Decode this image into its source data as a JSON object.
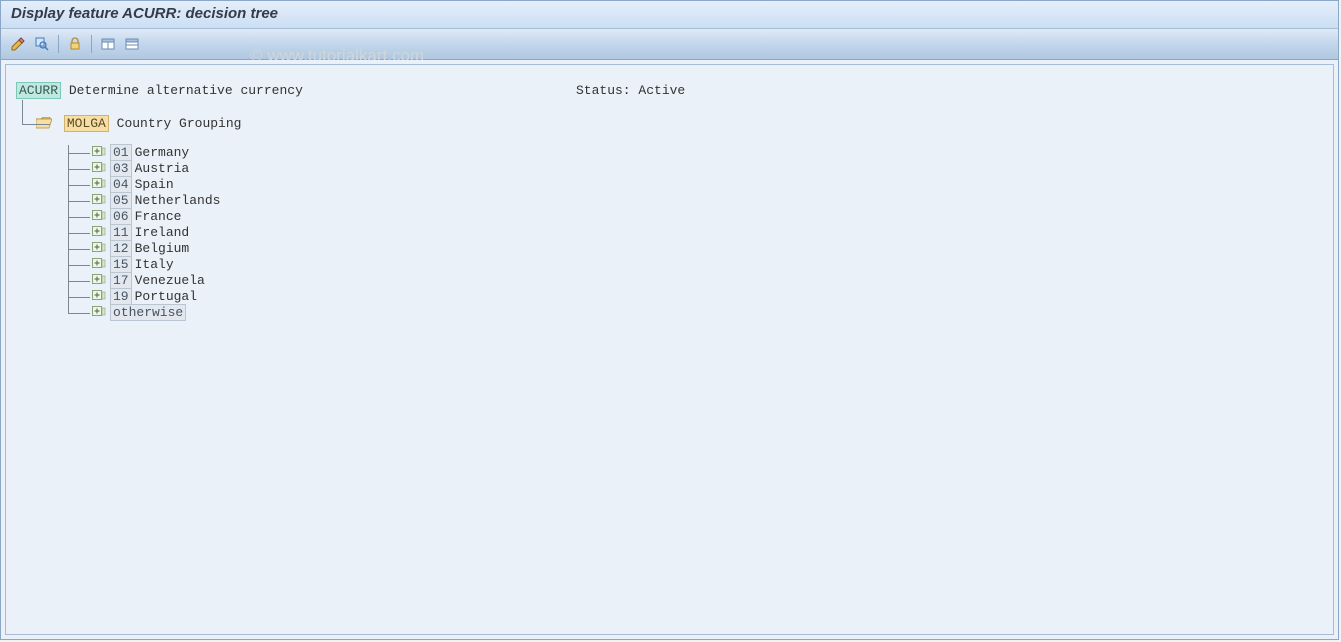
{
  "header": {
    "title": "Display feature ACURR: decision tree"
  },
  "toolbar": {
    "buttons": [
      "edit",
      "inspect",
      "lock",
      "layout1",
      "layout2"
    ]
  },
  "watermark": "© www.tutorialkart.com",
  "tree": {
    "root": {
      "code": "ACURR",
      "label": "Determine alternative currency"
    },
    "status_label": "Status:",
    "status_value": "Active",
    "group": {
      "code": "MOLGA",
      "label": "Country Grouping"
    },
    "items": [
      {
        "code": "01",
        "label": "Germany"
      },
      {
        "code": "03",
        "label": "Austria"
      },
      {
        "code": "04",
        "label": "Spain"
      },
      {
        "code": "05",
        "label": "Netherlands"
      },
      {
        "code": "06",
        "label": "France"
      },
      {
        "code": "11",
        "label": "Ireland"
      },
      {
        "code": "12",
        "label": "Belgium"
      },
      {
        "code": "15",
        "label": "Italy"
      },
      {
        "code": "17",
        "label": "Venezuela"
      },
      {
        "code": "19",
        "label": "Portugal"
      },
      {
        "code": "otherwise",
        "label": ""
      }
    ]
  }
}
